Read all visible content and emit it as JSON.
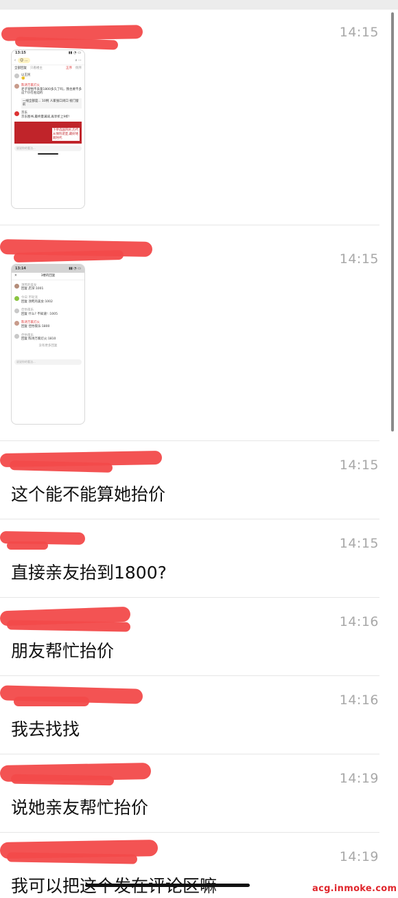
{
  "messages": [
    {
      "time": "14:15",
      "type": "image",
      "image": {
        "status_time": "13:15",
        "tabs": [
          "全部回复",
          "只看楼主",
          "正序",
          "倒序"
        ],
        "comments": [
          {
            "user": "以王民",
            "text": "🙂"
          },
          {
            "user": "陈诗万家灯火",
            "text": "老子宠物不丢第1800多久了吗，我也要不多这个价在右边的"
          },
          {
            "user": "",
            "text": "一线全部是... 10例 人家张口闭口 视门窗前"
          },
          {
            "user": "京东",
            "text": "京东图书,最终量满减,再享折上9折!"
          }
        ],
        "ad_text": "下单选国风好,历代从保险诺亚,最好地跨时代",
        "input_placeholder": "说说你的看法..."
      }
    },
    {
      "time": "14:15",
      "type": "image",
      "image": {
        "status_time": "13:14",
        "title": "3楼的回复",
        "comments": [
          {
            "user": "须死的美女",
            "text": "回复 店深:1001"
          },
          {
            "user": "今日 不轮流",
            "text": "回复 须死的美女:1002"
          },
          {
            "user": "佳怡夜乐",
            "text": "回复 什么? 不知道! :1005"
          },
          {
            "user": "陈诗万家灯火",
            "text": "回复 佳怡夜乐:1800"
          },
          {
            "user": "佳怡夜乐",
            "text": "回复 陈诗万家灯火:1810"
          }
        ],
        "footer": "没有更多回复",
        "input_placeholder": "说说你的看法..."
      }
    },
    {
      "time": "14:15",
      "type": "text",
      "text": "这个能不能算她抬价"
    },
    {
      "time": "14:15",
      "type": "text",
      "text": "直接亲友抬到1800?"
    },
    {
      "time": "14:16",
      "type": "text",
      "text": "朋友帮忙抬价"
    },
    {
      "time": "14:16",
      "type": "text",
      "text": "我去找找"
    },
    {
      "time": "14:19",
      "type": "text",
      "text": "说她亲友帮忙抬价"
    },
    {
      "time": "14:19",
      "type": "text",
      "text": "我可以把这个发在评论区嘛"
    }
  ],
  "watermark": "acg.inmoke.com",
  "colors": {
    "redaction": "#f24a4a",
    "time": "#a8a8a8"
  }
}
